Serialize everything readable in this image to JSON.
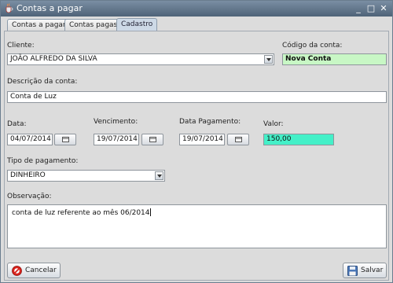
{
  "window": {
    "title": "Contas a pagar",
    "controls": {
      "minimize": "_",
      "maximize": "□",
      "close": "✕"
    }
  },
  "tabs": [
    {
      "label": "Contas a pagar",
      "active": false
    },
    {
      "label": "Contas pagas",
      "active": false
    },
    {
      "label": "Cadastro",
      "active": true
    }
  ],
  "form": {
    "cliente": {
      "label": "Cliente:",
      "value": "JOÃO ALFREDO DA SILVA"
    },
    "codigo": {
      "label": "Código da conta:",
      "value": "Nova Conta"
    },
    "descricao": {
      "label": "Descrição da conta:",
      "value": "Conta de Luz"
    },
    "data": {
      "label": "Data:",
      "value": "04/07/2014"
    },
    "vencimento": {
      "label": "Vencimento:",
      "value": "19/07/2014"
    },
    "data_pagamento": {
      "label": "Data Pagamento:",
      "value": "19/07/2014"
    },
    "valor": {
      "label": "Valor:",
      "value": "150,00"
    },
    "tipo_pagamento": {
      "label": "Tipo de pagamento:",
      "value": "DINHEIRO"
    },
    "observacao": {
      "label": "Observação:",
      "value": "conta de luz referente ao mês 06/2014"
    }
  },
  "buttons": {
    "cancel": "Cancelar",
    "save": "Salvar"
  },
  "colors": {
    "codigo_field_bg": "#c8f7c5",
    "valor_field_bg": "#44f0c8",
    "titlebar": "#5d7188",
    "active_tab": "#cdd9e6"
  },
  "icons": {
    "app": "java-cup-icon",
    "calendar": "calendar-icon",
    "cancel": "cancel-icon",
    "save": "floppy-disk-icon"
  }
}
